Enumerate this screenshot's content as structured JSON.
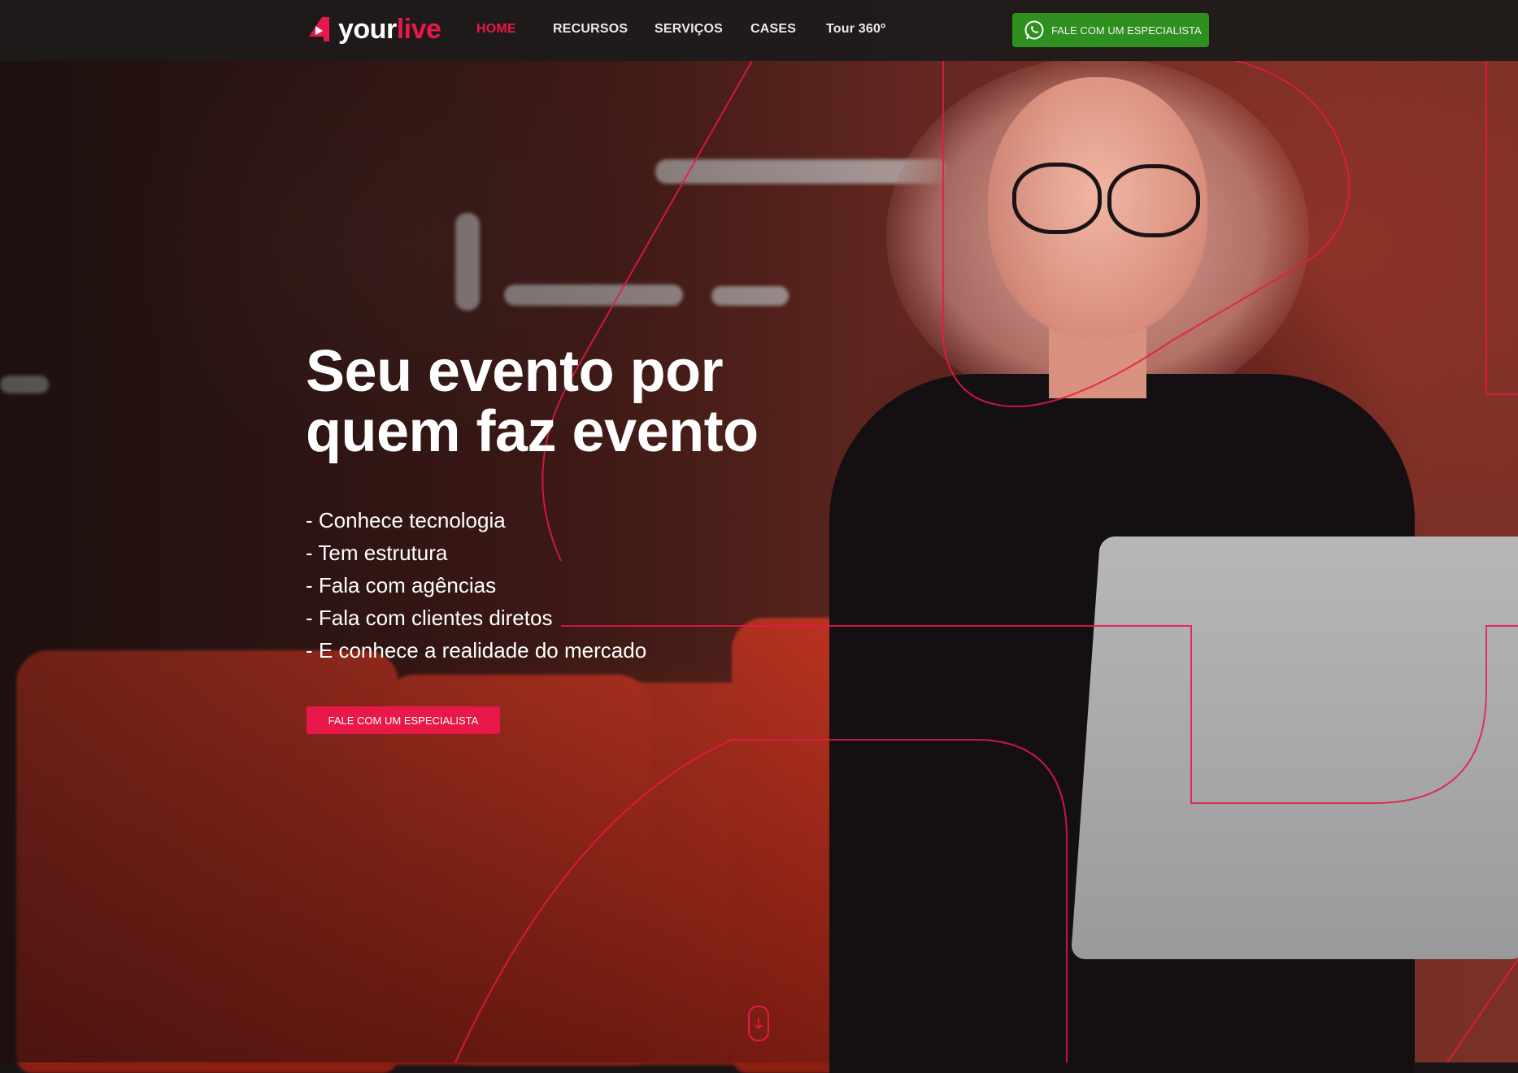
{
  "brand": {
    "logo_part1": "your",
    "logo_part2": "live",
    "accent_color": "#e9184a",
    "whatsapp_color": "#2f8f1f"
  },
  "nav": {
    "items": [
      {
        "label": "HOME",
        "active": true
      },
      {
        "label": "RECURSOS",
        "active": false
      },
      {
        "label": "SERVIÇOS",
        "active": false
      },
      {
        "label": "CASES",
        "active": false
      },
      {
        "label": "Tour 360º",
        "active": false
      }
    ],
    "whatsapp_button_label": "FALE COM UM ESPECIALISTA",
    "whatsapp_icon": "whatsapp-icon"
  },
  "hero": {
    "title_line1": "Seu evento por",
    "title_line2": "quem faz evento",
    "features": [
      "- Conhece tecnologia",
      "- Tem estrutura",
      "- Fala com agências",
      "- Fala com clientes diretos",
      "- E conhece a realidade do mercado"
    ],
    "cta_label": "FALE COM UM ESPECIALISTA",
    "scroll_icon": "arrow-down-icon"
  }
}
